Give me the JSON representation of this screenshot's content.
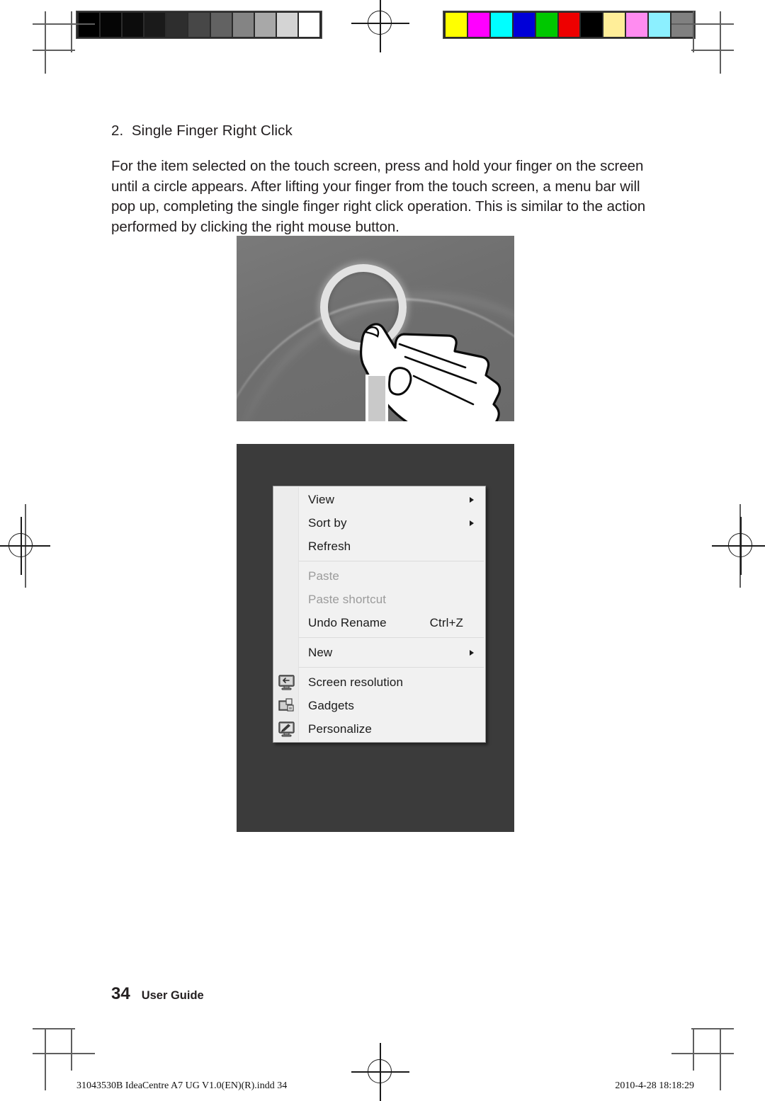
{
  "page": {
    "number": "34",
    "running_head": "User Guide"
  },
  "section": {
    "heading": "2.  Single Finger Right Click",
    "paragraph": "For the item selected on the touch screen, press and hold your finger on the screen until a circle appears. After lifting your finger from the touch screen, a menu bar will pop up, completing the single finger right click operation. This is similar to the action performed by clicking the right mouse button."
  },
  "figures": {
    "touch_photo": {
      "name": "hand-pressing-touch-screen-with-circle",
      "circle_indicator": "press-and-hold-circle"
    },
    "transition_arrow": {
      "name": "down-arrow",
      "color": "#c9c9c9"
    },
    "desktop_screenshot": {
      "name": "desktop-with-context-menu"
    }
  },
  "context_menu": {
    "groups": [
      {
        "items": [
          {
            "label": "View",
            "submenu": true,
            "disabled": false,
            "accel": "",
            "icon": ""
          },
          {
            "label": "Sort by",
            "submenu": true,
            "disabled": false,
            "accel": "",
            "icon": ""
          },
          {
            "label": "Refresh",
            "submenu": false,
            "disabled": false,
            "accel": "",
            "icon": ""
          }
        ]
      },
      {
        "items": [
          {
            "label": "Paste",
            "submenu": false,
            "disabled": true,
            "accel": "",
            "icon": ""
          },
          {
            "label": "Paste shortcut",
            "submenu": false,
            "disabled": true,
            "accel": "",
            "icon": ""
          },
          {
            "label": "Undo Rename",
            "submenu": false,
            "disabled": false,
            "accel": "Ctrl+Z",
            "icon": ""
          }
        ]
      },
      {
        "items": [
          {
            "label": "New",
            "submenu": true,
            "disabled": false,
            "accel": "",
            "icon": ""
          }
        ]
      },
      {
        "items": [
          {
            "label": "Screen resolution",
            "submenu": false,
            "disabled": false,
            "accel": "",
            "icon": "monitor-icon"
          },
          {
            "label": "Gadgets",
            "submenu": false,
            "disabled": false,
            "accel": "",
            "icon": "gadgets-icon"
          },
          {
            "label": "Personalize",
            "submenu": false,
            "disabled": false,
            "accel": "",
            "icon": "personalize-icon"
          }
        ]
      }
    ]
  },
  "footer": {
    "filename": "31043530B IdeaCentre A7 UG V1.0(EN)(R).indd   34",
    "timestamp": "2010-4-28   18:18:29"
  },
  "prepress": {
    "grayscale_label": "grayscale-calibration-bar",
    "grayscale_swatches": [
      "#000000",
      "#050505",
      "#0c0c0c",
      "#1a1a1a",
      "#2e2e2e",
      "#474747",
      "#626262",
      "#848484",
      "#a8a8a8",
      "#d4d4d4",
      "#ffffff"
    ],
    "colorbar_label": "color-calibration-bar",
    "colorbar_swatches": [
      "#ffff00",
      "#ff00ff",
      "#00ffff",
      "#0000d8",
      "#00c800",
      "#ee0000",
      "#000000",
      "#ffee99",
      "#ff8cf0",
      "#8cf0ff",
      "#808080"
    ]
  }
}
